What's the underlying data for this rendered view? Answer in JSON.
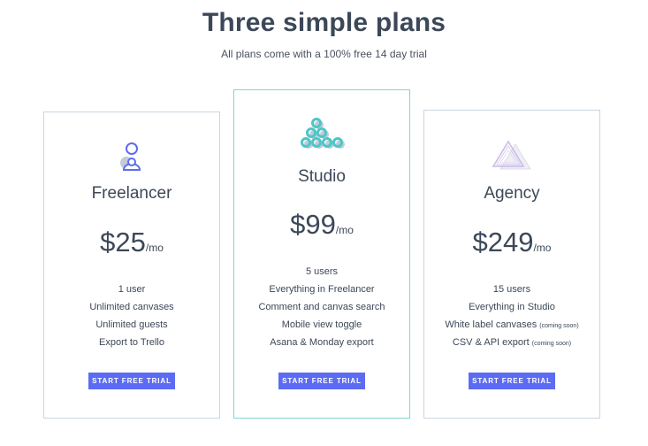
{
  "header": {
    "title": "Three simple plans",
    "subtitle": "All plans come with a 100% free 14 day trial"
  },
  "colors": {
    "button": "#5c6cf2",
    "featured_border": "#7fd6d3",
    "card_border": "#c9d6e3",
    "heading": "#3c4858"
  },
  "plans": [
    {
      "icon": "people-icon",
      "name": "Freelancer",
      "price": "$25",
      "period": "/mo",
      "features": [
        {
          "text": "1 user",
          "note": ""
        },
        {
          "text": "Unlimited canvases",
          "note": ""
        },
        {
          "text": "Unlimited guests",
          "note": ""
        },
        {
          "text": "Export to Trello",
          "note": ""
        }
      ],
      "cta": "START FREE TRIAL"
    },
    {
      "icon": "team-circles-icon",
      "name": "Studio",
      "price": "$99",
      "period": "/mo",
      "features": [
        {
          "text": "5 users",
          "note": ""
        },
        {
          "text": "Everything in Freelancer",
          "note": ""
        },
        {
          "text": "Comment and canvas search",
          "note": ""
        },
        {
          "text": "Mobile view toggle",
          "note": ""
        },
        {
          "text": "Asana & Monday export",
          "note": ""
        }
      ],
      "cta": "START FREE TRIAL"
    },
    {
      "icon": "triangle-icon",
      "name": "Agency",
      "price": "$249",
      "period": "/mo",
      "features": [
        {
          "text": "15 users",
          "note": ""
        },
        {
          "text": "Everything in Studio",
          "note": ""
        },
        {
          "text": "White label canvases",
          "note": "(coming soon)"
        },
        {
          "text": "CSV & API export",
          "note": "(coming soon)"
        }
      ],
      "cta": "START FREE TRIAL"
    }
  ]
}
